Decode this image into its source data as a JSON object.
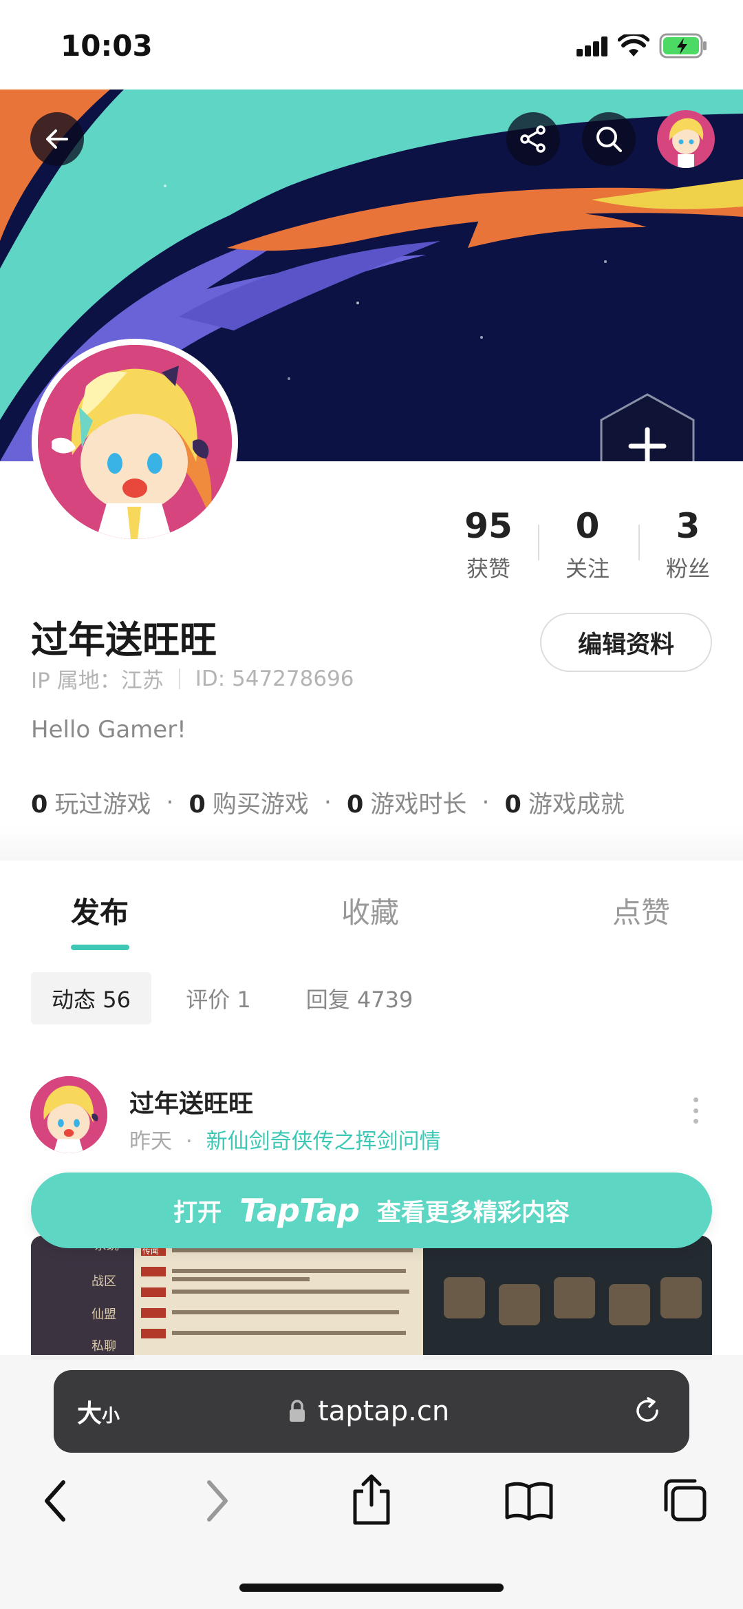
{
  "status_bar": {
    "time": "10:03"
  },
  "profile": {
    "username": "过年送旺旺",
    "ip_location": "IP 属地：江苏",
    "id": "ID: 547278696",
    "bio": "Hello Gamer!",
    "edit_button": "编辑资料"
  },
  "stats": [
    {
      "value": "95",
      "label": "获赞"
    },
    {
      "value": "0",
      "label": "关注"
    },
    {
      "value": "3",
      "label": "粉丝"
    }
  ],
  "game_stats": [
    {
      "value": "0",
      "label": "玩过游戏"
    },
    {
      "value": "0",
      "label": "购买游戏"
    },
    {
      "value": "0",
      "label": "游戏时长"
    },
    {
      "value": "0",
      "label": "游戏成就"
    }
  ],
  "tabs": [
    {
      "label": "发布",
      "active": true
    },
    {
      "label": "收藏",
      "active": false
    },
    {
      "label": "点赞",
      "active": false
    }
  ],
  "filters": [
    {
      "label": "动态 56",
      "active": true
    },
    {
      "label": "评价 1",
      "active": false
    },
    {
      "label": "回复 4739",
      "active": false
    }
  ],
  "post": {
    "author": "过年送旺旺",
    "time": "昨天",
    "separator": "·",
    "game": "新仙剑奇侠传之挥剑问情",
    "image_text": [
      "系统",
      "战区",
      "仙盟",
      "私聊",
      "传闻"
    ]
  },
  "open_banner": {
    "prefix": "打开",
    "brand": "TapTap",
    "suffix": "查看更多精彩内容"
  },
  "browser": {
    "text_size_label": "大",
    "text_size_small": "小",
    "url": "taptap.cn"
  },
  "icons": [
    "back-arrow-icon",
    "share-icon",
    "search-icon",
    "plus-icon",
    "more-icon",
    "lock-icon",
    "reload-icon",
    "nav-back-icon",
    "nav-forward-icon",
    "share-sheet-icon",
    "bookmarks-icon",
    "tabs-icon"
  ],
  "colors": {
    "accent": "#5dd6c3",
    "accent_text": "#3cc8b4",
    "banner_bg": "#0d1245",
    "avatar_bg": "#d6457e"
  }
}
